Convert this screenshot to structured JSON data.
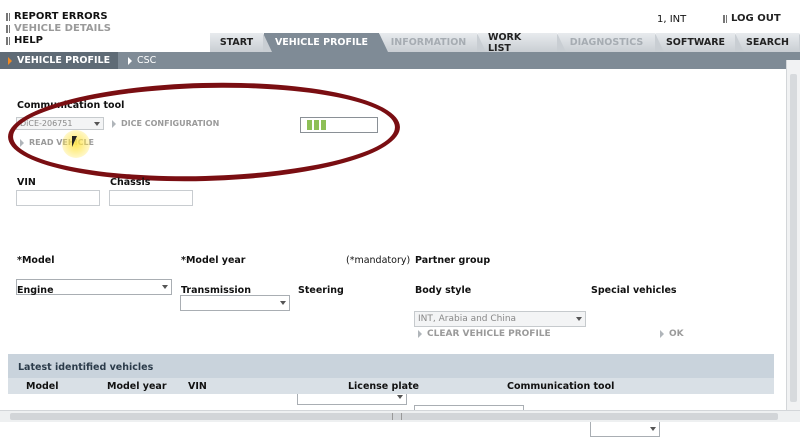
{
  "header": {
    "links": [
      {
        "label": "REPORT ERRORS"
      },
      {
        "label": "VEHICLE DETAILS"
      },
      {
        "label": "HELP"
      }
    ],
    "user": "1, INT",
    "logout_label": "LOG OUT"
  },
  "tabs": [
    {
      "label": "START",
      "state": "normal"
    },
    {
      "label": "VEHICLE PROFILE",
      "state": "active"
    },
    {
      "label": "INFORMATION",
      "state": "disabled"
    },
    {
      "label": "WORK LIST",
      "state": "normal"
    },
    {
      "label": "DIAGNOSTICS",
      "state": "disabled"
    },
    {
      "label": "SOFTWARE",
      "state": "normal"
    },
    {
      "label": "SEARCH",
      "state": "normal"
    }
  ],
  "subnav": {
    "active": "VEHICLE PROFILE",
    "other": "CSC"
  },
  "communication": {
    "label": "Communication tool",
    "selected": "DiCE-206751",
    "dice_config_label": "DICE CONFIGURATION",
    "read_vehicle_label": "READ VEHICLE",
    "progress_segments": 3
  },
  "vehicle": {
    "vin_label": "VIN",
    "vin_value": "",
    "chassis_label": "Chassis",
    "chassis_value": ""
  },
  "form": {
    "model_label": "*Model",
    "model_year_label": "*Model year",
    "mandatory_note": "(*mandatory)",
    "partner_group_label": "Partner group",
    "partner_group_value": "INT, Arabia and China",
    "engine_label": "Engine",
    "transmission_label": "Transmission",
    "steering_label": "Steering",
    "body_style_label": "Body style",
    "special_vehicles_label": "Special vehicles",
    "clear_label": "CLEAR VEHICLE PROFILE",
    "ok_label": "OK"
  },
  "latest": {
    "title": "Latest identified vehicles",
    "columns": [
      "Model",
      "Model year",
      "VIN",
      "License plate",
      "Communication tool"
    ]
  },
  "colors": {
    "accent": "#f08a24",
    "annotation": "#7a0e12",
    "nav": "#7f8b96"
  }
}
